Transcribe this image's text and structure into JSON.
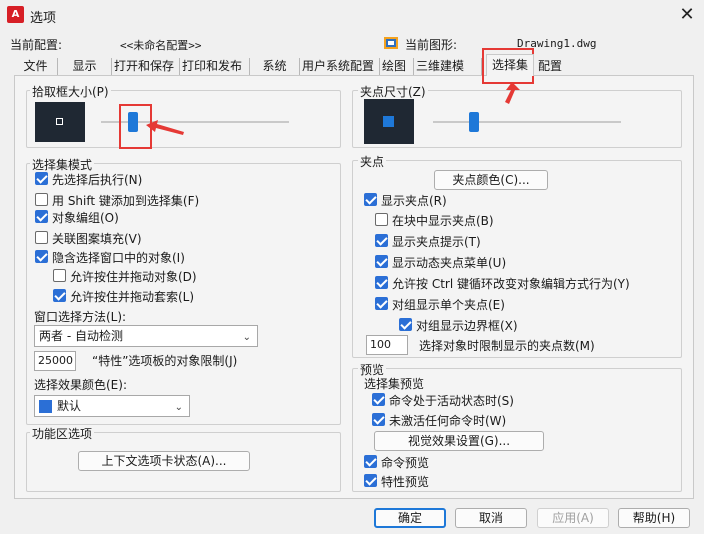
{
  "window": {
    "title": "选项",
    "close_glyph": "✕"
  },
  "profile": {
    "current_config_label": "当前配置:",
    "current_config_value": "<<未命名配置>>",
    "current_drawing_label": "当前图形:",
    "current_drawing_value": "Drawing1.dwg"
  },
  "tabs": [
    "文件",
    "显示",
    "打开和保存",
    "打印和发布",
    "系统",
    "用户系统配置",
    "绘图",
    "三维建模",
    "选择集",
    "配置"
  ],
  "active_tab": "选择集",
  "pickbox": {
    "label": "拾取框大小(P)",
    "slider_level": 0.15
  },
  "selection_modes": {
    "label": "选择集模式",
    "items": [
      {
        "label": "先选择后执行(N)",
        "checked": true
      },
      {
        "label": "用 Shift 键添加到选择集(F)",
        "checked": false
      },
      {
        "label": "对象编组(O)",
        "checked": true
      },
      {
        "label": "关联图案填充(V)",
        "checked": false
      },
      {
        "label": "隐含选择窗口中的对象(I)",
        "checked": true
      },
      {
        "label": "允许按住并拖动对象(D)",
        "checked": false
      },
      {
        "label": "允许按住并拖动套索(L)",
        "checked": true
      }
    ],
    "window_method_label": "窗口选择方法(L):",
    "window_method_value": "两者 - 自动检测",
    "limit_value": "25000",
    "limit_label": "“特性”选项板的对象限制(J)",
    "effect_color_label": "选择效果颜色(E):",
    "effect_color_value": "默认",
    "effect_color_swatch": "#2b6fd6"
  },
  "ribbon": {
    "label": "功能区选项",
    "button": "上下文选项卡状态(A)..."
  },
  "gripsize": {
    "label": "夹点尺寸(Z)",
    "slider_level": 0.2
  },
  "grips": {
    "label": "夹点",
    "color_button": "夹点颜色(C)...",
    "items": [
      {
        "label": "显示夹点(R)",
        "checked": true
      },
      {
        "label": "在块中显示夹点(B)",
        "checked": false
      },
      {
        "label": "显示夹点提示(T)",
        "checked": true
      },
      {
        "label": "显示动态夹点菜单(U)",
        "checked": true
      },
      {
        "label": "允许按 Ctrl 键循环改变对象编辑方式行为(Y)",
        "checked": true
      },
      {
        "label": "对组显示单个夹点(E)",
        "checked": true
      },
      {
        "label": "对组显示边界框(X)",
        "checked": true
      }
    ],
    "limit_value": "100",
    "limit_label": "选择对象时限制显示的夹点数(M)"
  },
  "preview": {
    "label": "预览",
    "sub_label": "选择集预览",
    "items": [
      {
        "label": "命令处于活动状态时(S)",
        "checked": true
      },
      {
        "label": "未激活任何命令时(W)",
        "checked": true
      }
    ],
    "effects_button": "视觉效果设置(G)...",
    "cmd_preview": {
      "label": "命令预览",
      "checked": true
    },
    "prop_preview": {
      "label": "特性预览",
      "checked": true
    }
  },
  "footer": {
    "ok": "确定",
    "cancel": "取消",
    "apply": "应用(A)",
    "help": "帮助(H)"
  },
  "colors": {
    "accent": "#1e78d8",
    "highlight": "#e53935",
    "preview_bg": "#1f2833"
  }
}
